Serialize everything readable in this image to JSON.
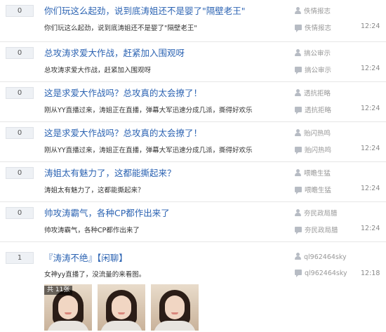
{
  "threads": [
    {
      "replies": "0",
      "title": "你们玩这么起劲，说到底涛姐还不是婴了\"隔壁老王\"",
      "abstract": "你们玩这么起劲，说到底涛姐还不是婴了\"隔壁老王\"",
      "author": "佚情报志",
      "last_replier": "佚情报志",
      "time": "12:24"
    },
    {
      "replies": "0",
      "title": "总攻涛求爱大作战，赶紧加入围观呀",
      "abstract": "总攻涛求爱大作战，赶紧加入围观呀",
      "author": "搞公审示",
      "last_replier": "搞公审示",
      "time": "12:24"
    },
    {
      "replies": "0",
      "title": "这是求爱大作战吗？总攻真的太会撩了！",
      "abstract": "刚从YY直播过来，涛姐正在直播，弹幕大军迅速分成几派，撕得好欢乐",
      "author": "透抗拒略",
      "last_replier": "透抗拒略",
      "time": "12:24"
    },
    {
      "replies": "0",
      "title": "这是求爱大作战吗？总攻真的太会撩了！",
      "abstract": "刚从YY直播过来，涛姐正在直播，弹幕大军迅速分成几派，撕得好欢乐",
      "author": "贻闪热鸣",
      "last_replier": "贻闪热鸣",
      "time": "12:24"
    },
    {
      "replies": "0",
      "title": "涛姐太有魅力了，这都能撕起来？",
      "abstract": "涛姐太有魅力了，这都能撕起来？",
      "author": "喂瞻生猛",
      "last_replier": "喂瞻生猛",
      "time": "12:24"
    },
    {
      "replies": "0",
      "title": "帅攻涛霸气，各种CP都作出来了",
      "abstract": "帅攻涛霸气，各种CP都作出来了",
      "author": "夯民政局腊",
      "last_replier": "夯民政局腊",
      "time": "12:24"
    },
    {
      "replies": "1",
      "title": "『涛涛不绝』【闲聊】",
      "abstract": "女神yy直播了，没流量的来看图。",
      "author": "ql962464sky",
      "last_replier": "ql962464sky",
      "time": "12:18",
      "images_badge": "共 11张"
    }
  ],
  "icons": {
    "author": "user-icon",
    "last_reply": "reply-bubble-icon"
  },
  "colors": {
    "title_link": "#2d64b3",
    "meta_text": "#999999",
    "reply_box_bg": "#eef1f5"
  }
}
